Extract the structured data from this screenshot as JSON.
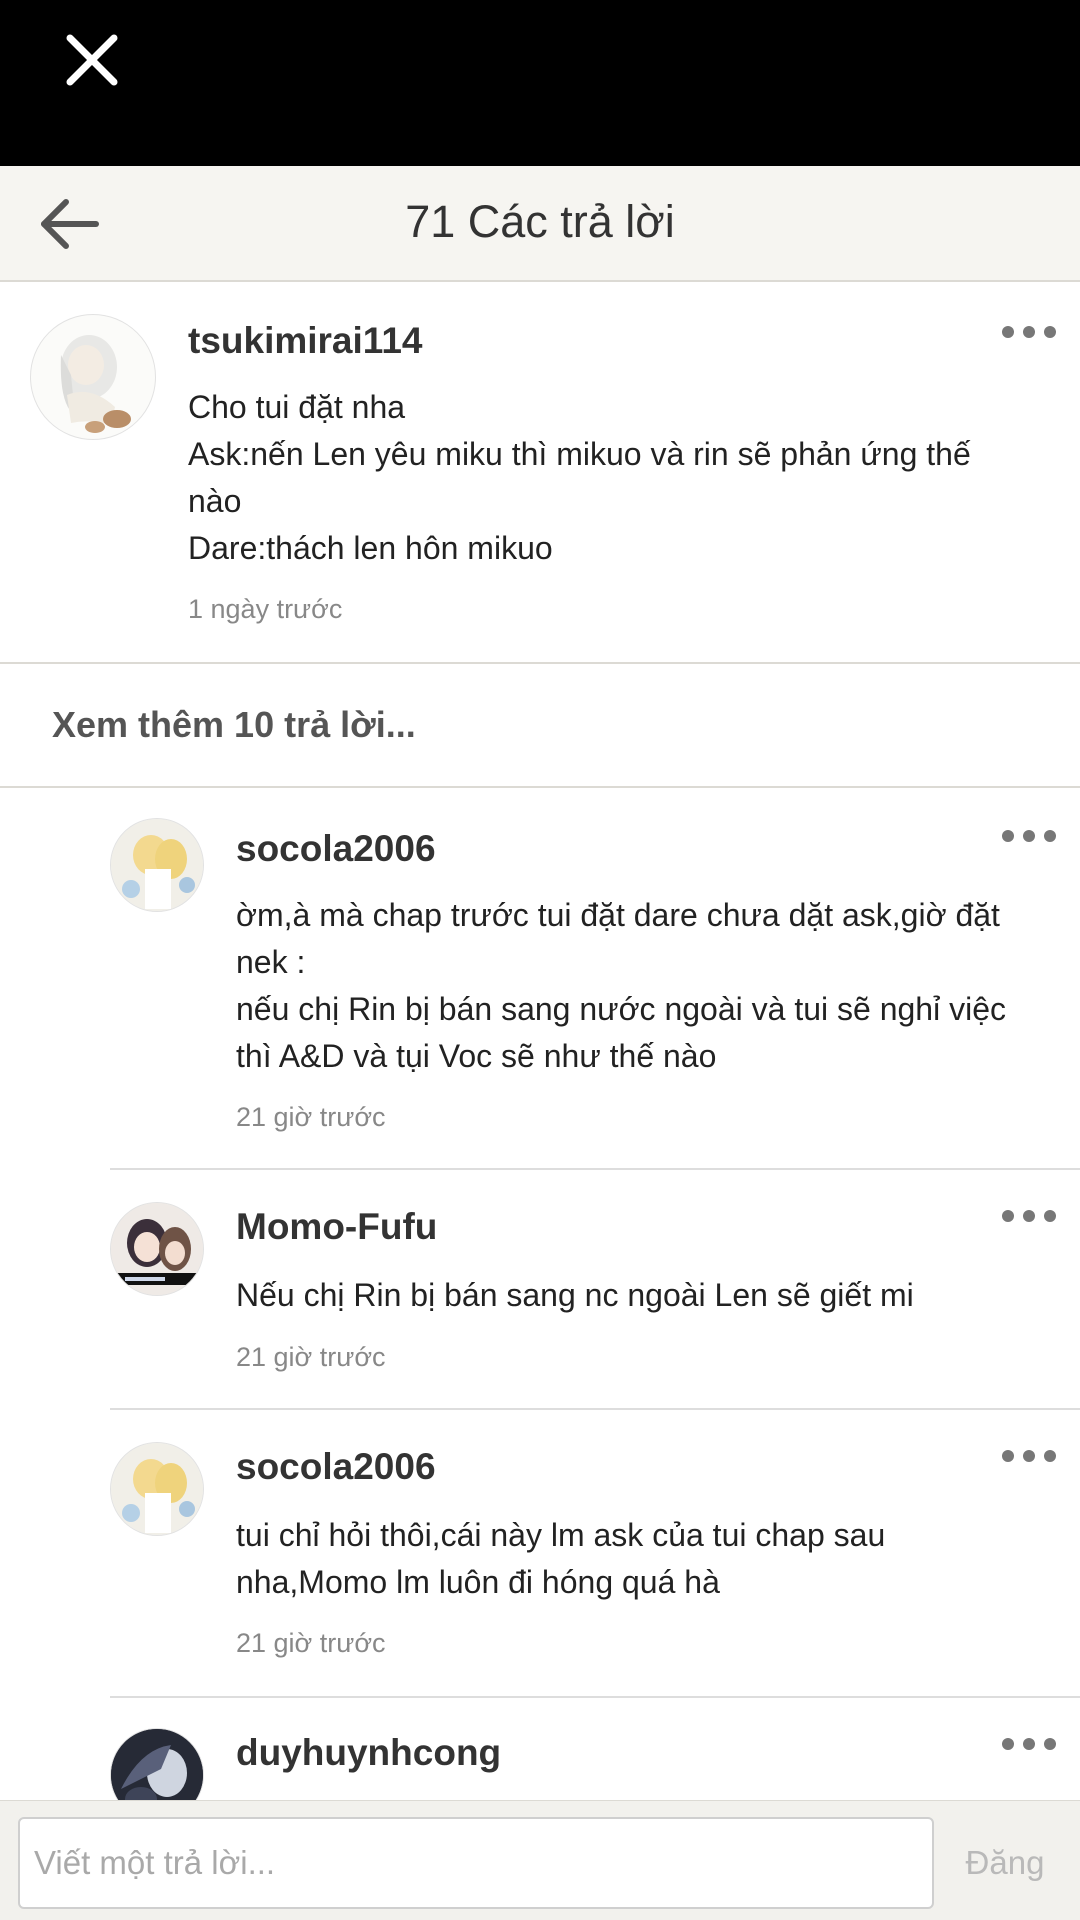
{
  "header": {
    "title": "71 Các trả lời"
  },
  "parent_comment": {
    "username": "tsukimirai114",
    "lines": [
      "Cho tui đặt nha",
      "Ask:nến Len yêu miku thì mikuo và rin sẽ phản ứng thế",
      "nào",
      "Dare:thách len hôn mikuo"
    ],
    "timestamp": "1 ngày trước"
  },
  "see_more": {
    "label": "Xem thêm 10 trả lời..."
  },
  "replies": [
    {
      "username": "socola2006",
      "lines": [
        "ờm,à mà chap trước tui đặt dare chưa dặt ask,giờ đặt",
        "nek :",
        "nếu chị Rin bị bán sang nước ngoài và tui sẽ nghỉ việc",
        "thì A&D và tụi Voc sẽ như thế nào"
      ],
      "timestamp": "21 giờ trước"
    },
    {
      "username": "Momo-Fufu",
      "lines": [
        "Nếu chị Rin bị bán sang nc ngoài Len sẽ giết mi"
      ],
      "timestamp": "21 giờ trước"
    },
    {
      "username": "socola2006",
      "lines": [
        "tui chỉ hỏi thôi,cái này lm ask của tui chap sau",
        "nha,Momo lm luôn đi hóng quá hà"
      ],
      "timestamp": "21 giờ trước"
    },
    {
      "username": "duyhuynhcong",
      "lines": [],
      "timestamp": ""
    }
  ],
  "reply_bar": {
    "placeholder": "Viết một trả lời...",
    "post_label": "Đăng"
  },
  "icons": {
    "close": "close-icon",
    "back": "back-arrow-icon",
    "more": "more-dots-icon"
  }
}
